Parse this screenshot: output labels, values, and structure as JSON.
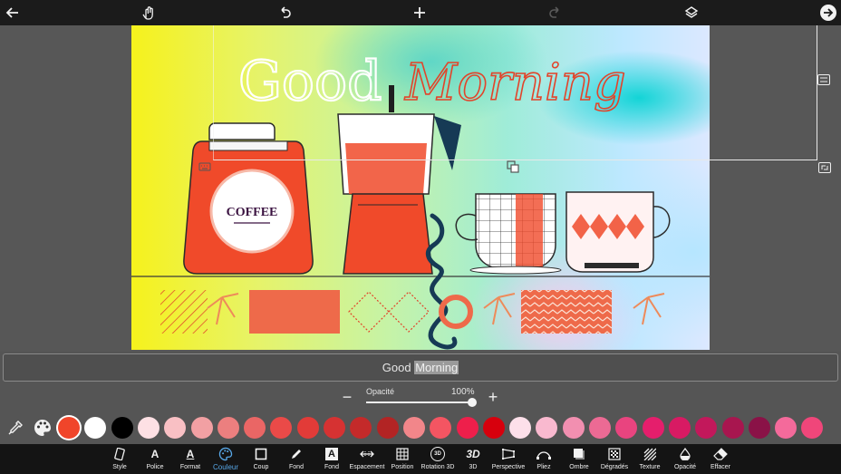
{
  "topbar": {
    "icons": [
      "back-arrow-icon",
      "hand-gesture-icon",
      "undo-icon",
      "add-icon",
      "redo-icon",
      "layers-icon",
      "forward-arrow-icon"
    ]
  },
  "canvas": {
    "title_word1": "Good",
    "title_word2": "Morning",
    "jar_label": "COFFEE",
    "colors": {
      "jar": "#f04a2a",
      "title_outline": "#ffffff",
      "title_script": "#e2442a",
      "accent_blue": "#163a55"
    }
  },
  "text_field": {
    "before_selection": "Good ",
    "selection": "Morning"
  },
  "opacity": {
    "label": "Opacité",
    "value": "100%",
    "level": 1.0,
    "minus": "−",
    "plus": "+"
  },
  "palette": {
    "selected": "#f0452a",
    "colors": [
      "#f0452a",
      "#ffffff",
      "#000000",
      "#fde0e4",
      "#f9c0c4",
      "#f2a0a3",
      "#ec7f7f",
      "#ea6665",
      "#ea4a48",
      "#e23b38",
      "#d63232",
      "#c42a2a",
      "#b22424",
      "#f2868a",
      "#f45562",
      "#ee1f4b",
      "#d7000d",
      "#fde0ea",
      "#f9b9cf",
      "#f28fb0",
      "#ec6a94",
      "#e9447f",
      "#e51e6c",
      "#d81a63",
      "#c2185b",
      "#a8164f",
      "#8a1247",
      "#f46a9b",
      "#f0467a"
    ]
  },
  "bottom_tools": [
    {
      "name": "style",
      "label": "Style",
      "icon": "style-icon"
    },
    {
      "name": "police",
      "label": "Police",
      "icon": "font-icon"
    },
    {
      "name": "format",
      "label": "Format",
      "icon": "format-icon"
    },
    {
      "name": "couleur",
      "label": "Couleur",
      "icon": "palette-icon",
      "active": true
    },
    {
      "name": "coup",
      "label": "Coup",
      "icon": "stroke-icon"
    },
    {
      "name": "fond-pen",
      "label": "Fond",
      "icon": "pen-icon"
    },
    {
      "name": "fond-box",
      "label": "Fond",
      "icon": "text-background-icon"
    },
    {
      "name": "espacement",
      "label": "Espacement",
      "icon": "spacing-icon"
    },
    {
      "name": "position",
      "label": "Position",
      "icon": "grid-icon"
    },
    {
      "name": "rotation-3d",
      "label": "Rotation 3D",
      "icon": "rotation-3d-icon"
    },
    {
      "name": "3d",
      "label": "3D",
      "icon": "3d-icon"
    },
    {
      "name": "perspective",
      "label": "Perspective",
      "icon": "perspective-icon"
    },
    {
      "name": "pliez",
      "label": "Pliez",
      "icon": "curve-icon"
    },
    {
      "name": "ombre",
      "label": "Ombre",
      "icon": "shadow-icon"
    },
    {
      "name": "degrades",
      "label": "Dégradés",
      "icon": "gradient-icon"
    },
    {
      "name": "texture",
      "label": "Texture",
      "icon": "texture-icon"
    },
    {
      "name": "opacite",
      "label": "Opacité",
      "icon": "opacity-icon"
    },
    {
      "name": "effacer",
      "label": "Effacer",
      "icon": "eraser-icon"
    }
  ],
  "icon_texts": {
    "style": "▯",
    "police": "A",
    "format": "A",
    "fond_box": "A",
    "threed": "3D",
    "rot3d": "3D"
  }
}
